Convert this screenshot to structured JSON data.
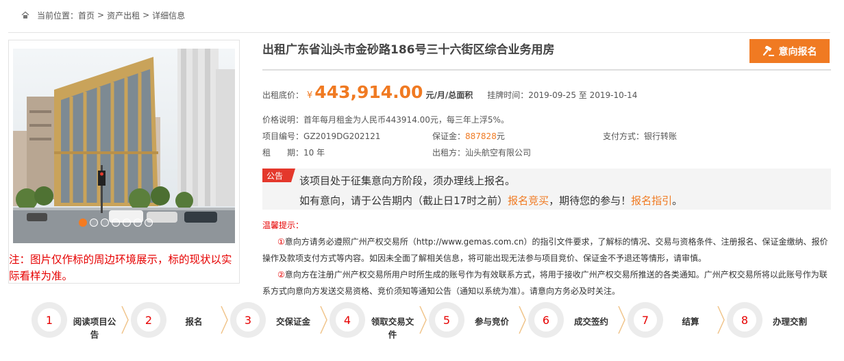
{
  "breadcrumb": {
    "prefix": "当前位置：",
    "items": [
      "首页",
      "资产出租",
      "详细信息"
    ],
    "separator": ">"
  },
  "property": {
    "title": "出租广东省汕头市金砂路186号三十六街区综合业务用房",
    "apply_button": "意向报名",
    "price_label": "出租底价：",
    "currency": "¥",
    "price": "443,914.00",
    "price_unit": "元/月/总面积",
    "listing_period_label": "挂牌时间：",
    "listing_period": "2019-09-25 至 2019-10-14",
    "price_note_label": "价格说明：",
    "price_note": "首年每月租金为人民币443914.00元，每三年上浮5%。",
    "project_no_label": "项目编号：",
    "project_no": "GZ2019DG202121",
    "deposit_label": "保证金：",
    "deposit_value": "887828",
    "deposit_unit": "元",
    "payment_label": "支付方式：",
    "payment": "银行转账",
    "term_label": "租　　期：",
    "term": "10 年",
    "lessor_label": "出租方：",
    "lessor": "汕头航空有限公司"
  },
  "photo": {
    "note": "注：图片仅作标的周边环境展示，标的现状以实际看样为准。",
    "slide_count": 7,
    "active_slide": 1
  },
  "notice": {
    "tag": "公告",
    "line1": "该项目处于征集意向方阶段，须办理线上报名。",
    "line2_a": "如有意向，请于公告期内（截止日17时之前）",
    "link1": "报名竞买",
    "line2_b": "，期待您的参与！",
    "link2": "报名指引",
    "line2_c": "。"
  },
  "tips": {
    "title": "温馨提示：",
    "p1_num": "①",
    "p1": "意向方请务必遵照广州产权交易所（http://www.gemas.com.cn）的指引文件要求，了解标的情况、交易与资格条件、注册报名、保证金缴纳、报价操作及款项支付方式等内容。如因未全面了解相关信息，将可能出现无法参与项目竞价、保证金不予退还等情形，请审慎。",
    "p2_num": "②",
    "p2": "意向方在注册广州产权交易所用户时所生成的账号作为有效联系方式，将用于接收广州产权交易所推送的各类通知。广州产权交易所将以此账号作为联系方式向意向方发送交易资格、竞价须知等通知公告（通知以系统为准）。请意向方务必及时关注。"
  },
  "steps": [
    {
      "num": "1",
      "label": "阅读项目公告"
    },
    {
      "num": "2",
      "label": "报名"
    },
    {
      "num": "3",
      "label": "交保证金"
    },
    {
      "num": "4",
      "label": "领取交易文件"
    },
    {
      "num": "5",
      "label": "参与竞价"
    },
    {
      "num": "6",
      "label": "成交签约"
    },
    {
      "num": "7",
      "label": "结算"
    },
    {
      "num": "8",
      "label": "办理交割"
    }
  ],
  "colors": {
    "accent": "#f07a22",
    "alert": "#e60000",
    "tag": "#e4382c"
  }
}
